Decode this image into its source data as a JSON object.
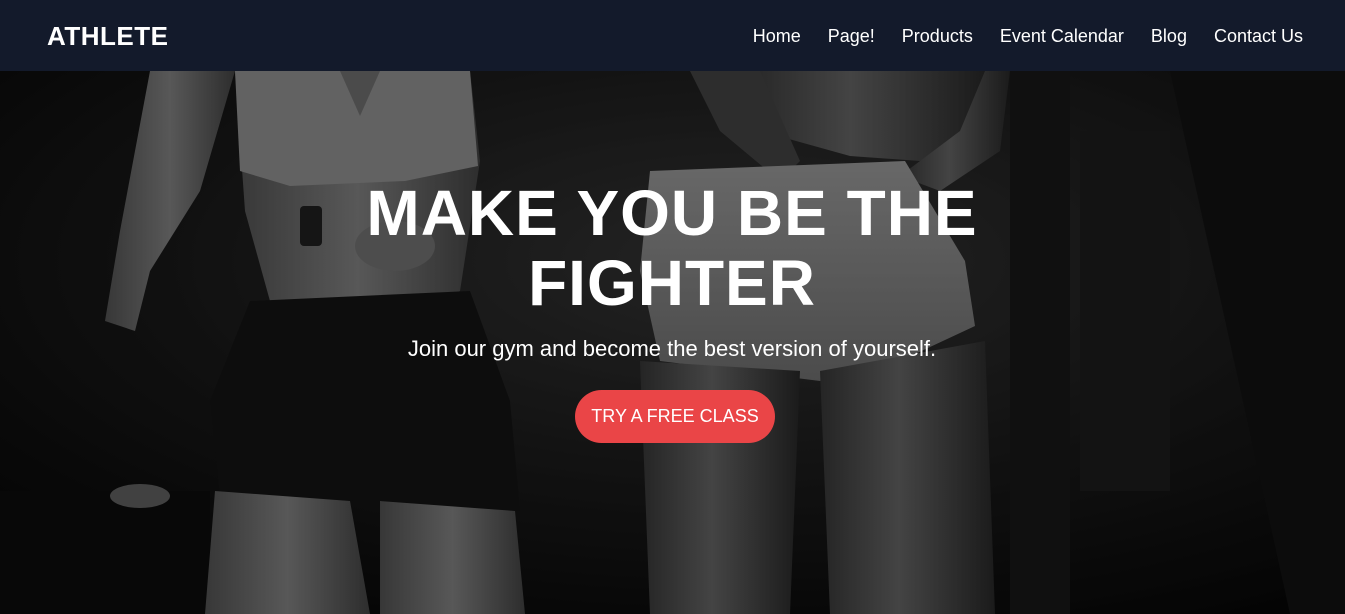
{
  "navbar": {
    "brand": "ATHLETE",
    "links": [
      {
        "label": "Home"
      },
      {
        "label": "Page!"
      },
      {
        "label": "Products"
      },
      {
        "label": "Event Calendar"
      },
      {
        "label": "Blog"
      },
      {
        "label": "Contact Us"
      }
    ]
  },
  "hero": {
    "title": "MAKE YOU BE THE FIGHTER",
    "subtitle": "Join our gym and become the best version of yourself.",
    "cta_label": "TRY A FREE CLASS",
    "cta_color": "#ea4547",
    "background_image": "grayscale gym photo of two athletes"
  },
  "colors": {
    "navbar_bg": "#131a2b",
    "text": "#ffffff",
    "accent": "#ea4547"
  }
}
